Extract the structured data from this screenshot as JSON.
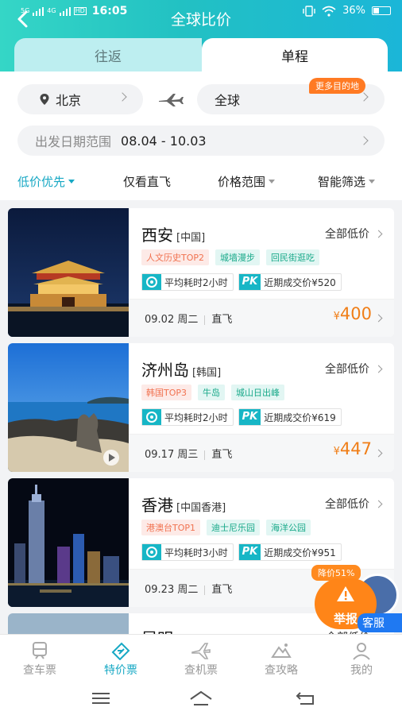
{
  "status_bar": {
    "signal1": "5G",
    "signal2": "4G",
    "hd": "HD",
    "time": "16:05",
    "battery": "36%"
  },
  "header": {
    "title": "全球比价"
  },
  "trip_tabs": {
    "round_trip": "往返",
    "one_way": "单程"
  },
  "search": {
    "from_city": "北京",
    "to_city": "全球",
    "more_destinations": "更多目的地",
    "date_label": "出发日期范围",
    "date_value": "08.04 - 10.03"
  },
  "filters": {
    "low_price": "低价优先",
    "direct_only": "仅看直飞",
    "price_range": "价格范围",
    "smart_filter": "智能筛选"
  },
  "cards": [
    {
      "city": "西安",
      "country": "[中国]",
      "all_low": "全部低价",
      "tags": [
        "人文历史TOP2",
        "城墙漫步",
        "回民街逛吃"
      ],
      "avg_time": "平均耗时2小时",
      "pk": "PK",
      "recent_price": "近期成交价¥520",
      "date": "09.02 周二",
      "flight_type": "直飞",
      "currency": "¥",
      "price": "400"
    },
    {
      "city": "济州岛",
      "country": "[韩国]",
      "all_low": "全部低价",
      "tags": [
        "韩国TOP3",
        "牛岛",
        "城山日出峰"
      ],
      "avg_time": "平均耗时2小时",
      "pk": "PK",
      "recent_price": "近期成交价¥619",
      "date": "09.17 周三",
      "flight_type": "直飞",
      "currency": "¥",
      "price": "447"
    },
    {
      "city": "香港",
      "country": "[中国香港]",
      "all_low": "全部低价",
      "tags": [
        "港澳台TOP1",
        "迪士尼乐园",
        "海洋公园"
      ],
      "avg_time": "平均耗时3小时",
      "pk": "PK",
      "recent_price": "近期成交价¥951",
      "date": "09.23 周二",
      "flight_type": "直飞",
      "currency": "¥",
      "price": ""
    }
  ],
  "partial_card": {
    "city": "昆明",
    "all_low": "全部低价"
  },
  "floating": {
    "discount": "降价51%",
    "report": "举报",
    "customer_service": "客服"
  },
  "tabbar": [
    {
      "label": "查车票",
      "icon": "train-icon"
    },
    {
      "label": "特价票",
      "icon": "ticket-icon"
    },
    {
      "label": "查机票",
      "icon": "plane-icon"
    },
    {
      "label": "查攻略",
      "icon": "mountain-icon"
    },
    {
      "label": "我的",
      "icon": "user-icon"
    }
  ],
  "colors": {
    "accent": "#17a8c4",
    "price": "#f07e17",
    "header_start": "#35d6c6",
    "header_end": "#1bb6d8"
  }
}
